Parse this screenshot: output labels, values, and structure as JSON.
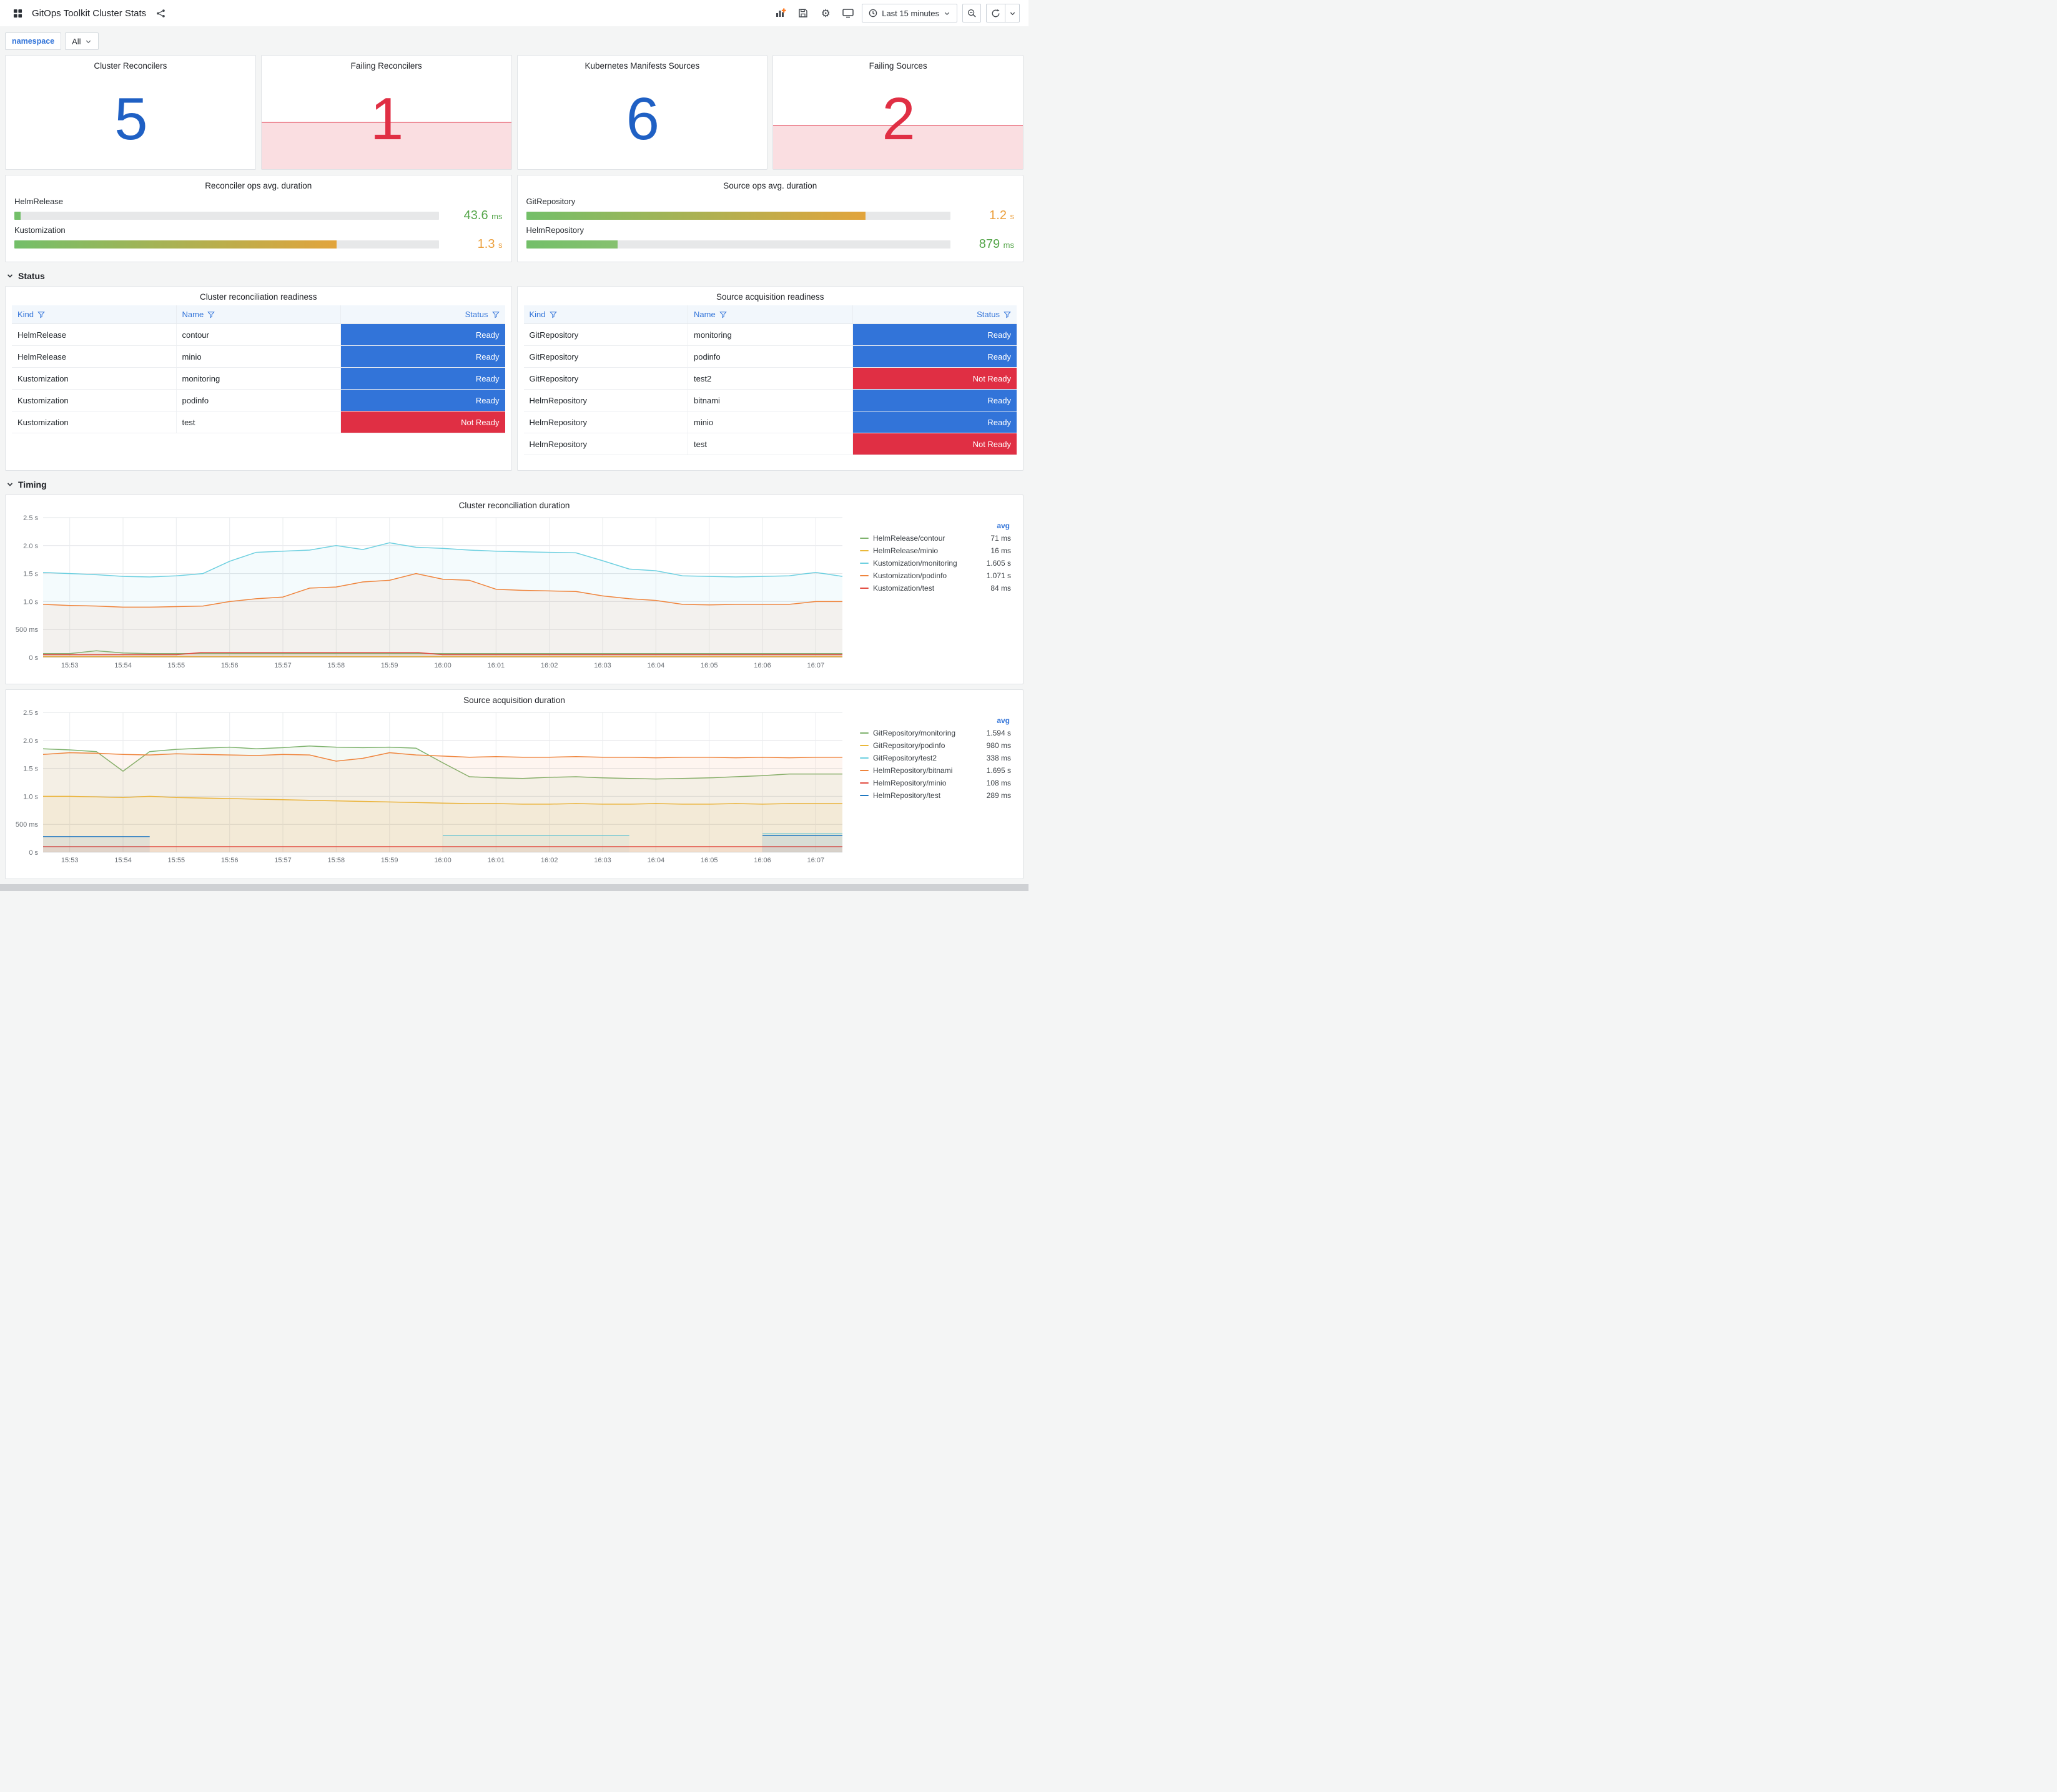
{
  "header": {
    "title": "GitOps Toolkit Cluster Stats",
    "time_range": "Last 15 minutes"
  },
  "variables": {
    "label": "namespace",
    "value": "All"
  },
  "sections": {
    "status": "Status",
    "timing": "Timing"
  },
  "colors": {
    "stat_blue": "#1F60C4",
    "stat_red": "#E02F44",
    "ready_blue": "#3274D9",
    "not_ready_red": "#E02F44"
  },
  "stats": [
    {
      "title": "Cluster Reconcilers",
      "value": "5",
      "color": "#1F60C4",
      "band_pct": 0
    },
    {
      "title": "Failing Reconcilers",
      "value": "1",
      "color": "#E02F44",
      "band_pct": 42
    },
    {
      "title": "Kubernetes Manifests Sources",
      "value": "6",
      "color": "#1F60C4",
      "band_pct": 0
    },
    {
      "title": "Failing Sources",
      "value": "2",
      "color": "#E02F44",
      "band_pct": 39
    }
  ],
  "gauges": [
    {
      "title": "Reconciler ops avg. duration",
      "rows": [
        {
          "label": "HelmRelease",
          "value": "43.6",
          "unit": "ms",
          "fraction": 0.015,
          "value_color": "#56A64B",
          "bar_from": "#73BF69",
          "bar_to": "#73BF69"
        },
        {
          "label": "Kustomization",
          "value": "1.3",
          "unit": "s",
          "fraction": 0.76,
          "value_color": "#EB9E3A",
          "bar_from": "#73BF69",
          "bar_to": "#E2A43C"
        }
      ]
    },
    {
      "title": "Source ops avg. duration",
      "rows": [
        {
          "label": "GitRepository",
          "value": "1.2",
          "unit": "s",
          "fraction": 0.8,
          "value_color": "#EB9E3A",
          "bar_from": "#73BF69",
          "bar_to": "#E2A43C"
        },
        {
          "label": "HelmRepository",
          "value": "879",
          "unit": "ms",
          "fraction": 0.215,
          "value_color": "#56A64B",
          "bar_from": "#73BF69",
          "bar_to": "#86C16F"
        }
      ]
    }
  ],
  "status_colors": {
    "Ready": "#3274D9",
    "Not Ready": "#E02F44"
  },
  "tables": [
    {
      "title": "Cluster reconciliation readiness",
      "columns": [
        "Kind",
        "Name",
        "Status"
      ],
      "rows": [
        [
          "HelmRelease",
          "contour",
          "Ready"
        ],
        [
          "HelmRelease",
          "minio",
          "Ready"
        ],
        [
          "Kustomization",
          "monitoring",
          "Ready"
        ],
        [
          "Kustomization",
          "podinfo",
          "Ready"
        ],
        [
          "Kustomization",
          "test",
          "Not Ready"
        ]
      ]
    },
    {
      "title": "Source acquisition readiness",
      "columns": [
        "Kind",
        "Name",
        "Status"
      ],
      "rows": [
        [
          "GitRepository",
          "monitoring",
          "Ready"
        ],
        [
          "GitRepository",
          "podinfo",
          "Ready"
        ],
        [
          "GitRepository",
          "test2",
          "Not Ready"
        ],
        [
          "HelmRepository",
          "bitnami",
          "Ready"
        ],
        [
          "HelmRepository",
          "minio",
          "Ready"
        ],
        [
          "HelmRepository",
          "test",
          "Not Ready"
        ]
      ]
    }
  ],
  "charts": [
    {
      "title": "Cluster reconciliation duration",
      "type": "line",
      "legend_header": "avg",
      "y_max": 2.5,
      "y_ticks": [
        {
          "v": 0,
          "label": "0 s"
        },
        {
          "v": 0.5,
          "label": "500 ms"
        },
        {
          "v": 1.0,
          "label": "1.0 s"
        },
        {
          "v": 1.5,
          "label": "1.5 s"
        },
        {
          "v": 2.0,
          "label": "2.0 s"
        },
        {
          "v": 2.5,
          "label": "2.5 s"
        }
      ],
      "x_ticks": [
        {
          "i": 1,
          "label": "15:53"
        },
        {
          "i": 3,
          "label": "15:54"
        },
        {
          "i": 5,
          "label": "15:55"
        },
        {
          "i": 7,
          "label": "15:56"
        },
        {
          "i": 9,
          "label": "15:57"
        },
        {
          "i": 11,
          "label": "15:58"
        },
        {
          "i": 13,
          "label": "15:59"
        },
        {
          "i": 15,
          "label": "16:00"
        },
        {
          "i": 17,
          "label": "16:01"
        },
        {
          "i": 19,
          "label": "16:02"
        },
        {
          "i": 21,
          "label": "16:03"
        },
        {
          "i": 23,
          "label": "16:04"
        },
        {
          "i": 25,
          "label": "16:05"
        },
        {
          "i": 27,
          "label": "16:06"
        },
        {
          "i": 29,
          "label": "16:07"
        }
      ],
      "series": [
        {
          "name": "HelmRelease/contour",
          "color": "#7EB26D",
          "avg": "71 ms",
          "values": [
            0.07,
            0.07,
            0.12,
            0.08,
            0.07,
            0.07,
            0.07,
            0.07,
            0.07,
            0.07,
            0.07,
            0.07,
            0.07,
            0.07,
            0.07,
            0.07,
            0.07,
            0.07,
            0.07,
            0.07,
            0.07,
            0.07,
            0.07,
            0.07,
            0.07,
            0.07,
            0.07,
            0.07,
            0.07,
            0.07,
            0.07
          ]
        },
        {
          "name": "HelmRelease/minio",
          "color": "#EAB839",
          "avg": "16 ms",
          "values": [
            0.016,
            0.016,
            0.016,
            0.016,
            0.016,
            0.016,
            0.016,
            0.016,
            0.016,
            0.016,
            0.016,
            0.016,
            0.016,
            0.016,
            0.016,
            0.016,
            0.016,
            0.016,
            0.016,
            0.016,
            0.016,
            0.016,
            0.016,
            0.016,
            0.016,
            0.016,
            0.016,
            0.016,
            0.016,
            0.016,
            0.016
          ]
        },
        {
          "name": "Kustomization/monitoring",
          "color": "#6ED0E0",
          "avg": "1.605 s",
          "values": [
            1.52,
            1.5,
            1.48,
            1.45,
            1.44,
            1.46,
            1.5,
            1.72,
            1.88,
            1.9,
            1.92,
            2.0,
            1.93,
            2.05,
            1.97,
            1.95,
            1.92,
            1.9,
            1.89,
            1.88,
            1.87,
            1.73,
            1.58,
            1.55,
            1.46,
            1.45,
            1.44,
            1.45,
            1.46,
            1.52,
            1.45
          ]
        },
        {
          "name": "Kustomization/podinfo",
          "color": "#EF843C",
          "avg": "1.071 s",
          "values": [
            0.95,
            0.93,
            0.92,
            0.9,
            0.9,
            0.91,
            0.92,
            1.0,
            1.05,
            1.08,
            1.24,
            1.26,
            1.35,
            1.38,
            1.5,
            1.4,
            1.38,
            1.22,
            1.2,
            1.19,
            1.18,
            1.1,
            1.05,
            1.02,
            0.95,
            0.94,
            0.95,
            0.95,
            0.95,
            1.0,
            1.0
          ]
        },
        {
          "name": "Kustomization/test",
          "color": "#E24D42",
          "avg": "84 ms",
          "values": [
            0.05,
            0.05,
            0.05,
            0.05,
            0.05,
            0.05,
            0.09,
            0.09,
            0.09,
            0.09,
            0.09,
            0.09,
            0.09,
            0.09,
            0.09,
            0.05,
            0.05,
            0.05,
            0.05,
            0.05,
            0.05,
            0.05,
            0.05,
            0.05,
            0.05,
            0.05,
            0.05,
            0.05,
            0.05,
            0.05,
            0.05
          ]
        }
      ]
    },
    {
      "title": "Source acquisition duration",
      "type": "line",
      "legend_header": "avg",
      "y_max": 2.5,
      "y_ticks": [
        {
          "v": 0,
          "label": "0 s"
        },
        {
          "v": 0.5,
          "label": "500 ms"
        },
        {
          "v": 1.0,
          "label": "1.0 s"
        },
        {
          "v": 1.5,
          "label": "1.5 s"
        },
        {
          "v": 2.0,
          "label": "2.0 s"
        },
        {
          "v": 2.5,
          "label": "2.5 s"
        }
      ],
      "x_ticks": [
        {
          "i": 1,
          "label": "15:53"
        },
        {
          "i": 3,
          "label": "15:54"
        },
        {
          "i": 5,
          "label": "15:55"
        },
        {
          "i": 7,
          "label": "15:56"
        },
        {
          "i": 9,
          "label": "15:57"
        },
        {
          "i": 11,
          "label": "15:58"
        },
        {
          "i": 13,
          "label": "15:59"
        },
        {
          "i": 15,
          "label": "16:00"
        },
        {
          "i": 17,
          "label": "16:01"
        },
        {
          "i": 19,
          "label": "16:02"
        },
        {
          "i": 21,
          "label": "16:03"
        },
        {
          "i": 23,
          "label": "16:04"
        },
        {
          "i": 25,
          "label": "16:05"
        },
        {
          "i": 27,
          "label": "16:06"
        },
        {
          "i": 29,
          "label": "16:07"
        }
      ],
      "series": [
        {
          "name": "GitRepository/monitoring",
          "color": "#7EB26D",
          "avg": "1.594 s",
          "values": [
            1.85,
            1.83,
            1.8,
            1.45,
            1.8,
            1.84,
            1.86,
            1.88,
            1.85,
            1.87,
            1.9,
            1.88,
            1.87,
            1.88,
            1.86,
            1.6,
            1.35,
            1.33,
            1.32,
            1.34,
            1.35,
            1.33,
            1.32,
            1.31,
            1.32,
            1.33,
            1.35,
            1.37,
            1.4,
            1.4,
            1.4
          ]
        },
        {
          "name": "GitRepository/podinfo",
          "color": "#EAB839",
          "avg": "980 ms",
          "values": [
            1.0,
            1.0,
            0.99,
            0.98,
            1.0,
            0.98,
            0.97,
            0.96,
            0.95,
            0.94,
            0.93,
            0.92,
            0.91,
            0.9,
            0.89,
            0.88,
            0.87,
            0.87,
            0.86,
            0.86,
            0.87,
            0.86,
            0.86,
            0.87,
            0.86,
            0.86,
            0.87,
            0.86,
            0.87,
            0.87,
            0.87
          ]
        },
        {
          "name": "GitRepository/test2",
          "color": "#6ED0E0",
          "avg": "338 ms",
          "values": [
            null,
            null,
            null,
            null,
            null,
            null,
            null,
            null,
            null,
            null,
            null,
            null,
            null,
            null,
            null,
            0.3,
            0.3,
            0.3,
            0.3,
            0.3,
            0.3,
            0.3,
            0.3,
            null,
            null,
            null,
            null,
            0.33,
            0.33,
            0.33,
            0.33
          ]
        },
        {
          "name": "HelmRepository/bitnami",
          "color": "#EF843C",
          "avg": "1.695 s",
          "values": [
            1.75,
            1.78,
            1.77,
            1.75,
            1.74,
            1.76,
            1.75,
            1.74,
            1.73,
            1.75,
            1.74,
            1.63,
            1.68,
            1.78,
            1.74,
            1.72,
            1.7,
            1.71,
            1.7,
            1.7,
            1.71,
            1.7,
            1.7,
            1.69,
            1.7,
            1.7,
            1.69,
            1.7,
            1.69,
            1.7,
            1.7
          ]
        },
        {
          "name": "HelmRepository/minio",
          "color": "#E24D42",
          "avg": "108 ms",
          "values": [
            0.1,
            0.1,
            0.1,
            0.1,
            0.1,
            0.1,
            0.1,
            0.1,
            0.1,
            0.1,
            0.1,
            0.1,
            0.1,
            0.1,
            0.1,
            0.1,
            0.1,
            0.1,
            0.1,
            0.1,
            0.1,
            0.1,
            0.1,
            0.1,
            0.1,
            0.1,
            0.1,
            0.1,
            0.1,
            0.1,
            0.1
          ]
        },
        {
          "name": "HelmRepository/test",
          "color": "#1F78C1",
          "avg": "289 ms",
          "values": [
            0.28,
            0.28,
            0.28,
            0.28,
            0.28,
            null,
            null,
            null,
            null,
            null,
            null,
            null,
            null,
            null,
            null,
            null,
            null,
            null,
            null,
            null,
            null,
            null,
            null,
            null,
            null,
            null,
            null,
            0.3,
            0.3,
            0.3,
            0.3
          ]
        }
      ]
    }
  ]
}
